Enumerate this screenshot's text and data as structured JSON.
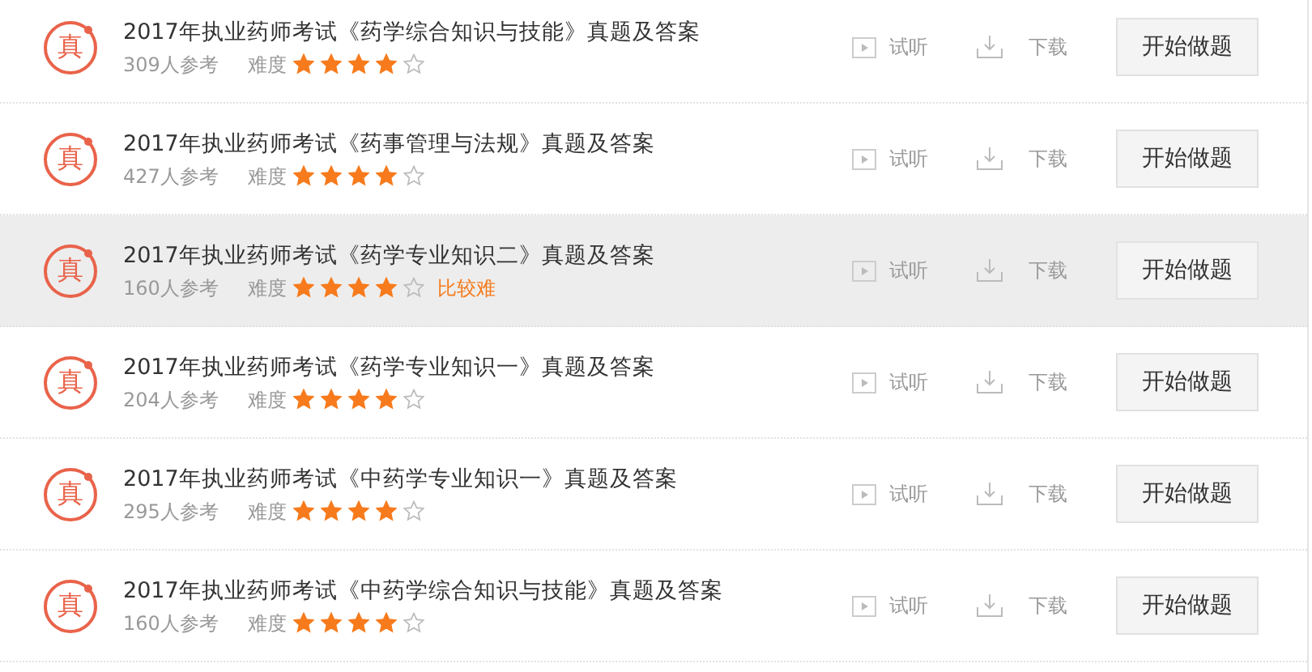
{
  "exams": [
    {
      "badge": "真",
      "title": "2017年执业药师考试《药学综合知识与技能》真题及答案",
      "participants": "309人参考",
      "difficulty_label": "难度",
      "stars": 4,
      "highlighted": false,
      "listen": "试听",
      "download": "下载",
      "start": "开始做题"
    },
    {
      "badge": "真",
      "title": "2017年执业药师考试《药事管理与法规》真题及答案",
      "participants": "427人参考",
      "difficulty_label": "难度",
      "stars": 4,
      "highlighted": false,
      "listen": "试听",
      "download": "下载",
      "start": "开始做题"
    },
    {
      "badge": "真",
      "title": "2017年执业药师考试《药学专业知识二》真题及答案",
      "participants": "160人参考",
      "difficulty_label": "难度",
      "stars": 4,
      "difficulty_note": "比较难",
      "highlighted": true,
      "listen": "试听",
      "download": "下载",
      "start": "开始做题"
    },
    {
      "badge": "真",
      "title": "2017年执业药师考试《药学专业知识一》真题及答案",
      "participants": "204人参考",
      "difficulty_label": "难度",
      "stars": 4,
      "highlighted": false,
      "listen": "试听",
      "download": "下载",
      "start": "开始做题"
    },
    {
      "badge": "真",
      "title": "2017年执业药师考试《中药学专业知识一》真题及答案",
      "participants": "295人参考",
      "difficulty_label": "难度",
      "stars": 4,
      "highlighted": false,
      "listen": "试听",
      "download": "下载",
      "start": "开始做题"
    },
    {
      "badge": "真",
      "title": "2017年执业药师考试《中药学综合知识与技能》真题及答案",
      "participants": "160人参考",
      "difficulty_label": "难度",
      "stars": 4,
      "highlighted": false,
      "listen": "试听",
      "download": "下载",
      "start": "开始做题"
    }
  ]
}
